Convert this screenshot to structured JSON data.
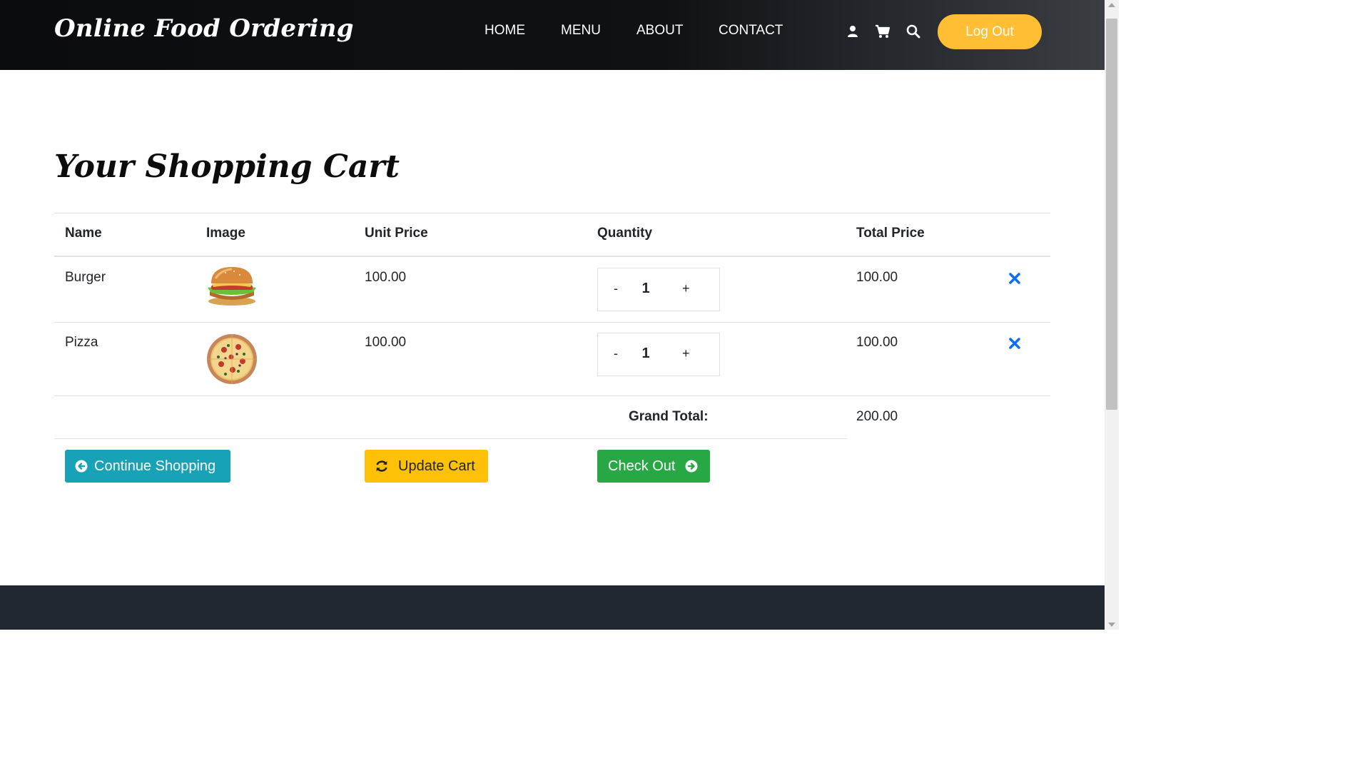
{
  "header": {
    "brand": "Online Food Ordering",
    "nav": [
      "HOME",
      "MENU",
      "ABOUT",
      "CONTACT"
    ],
    "icons": [
      "user-icon",
      "cart-icon",
      "search-icon"
    ],
    "logout_label": "Log Out",
    "accent_color": "#ffbe33"
  },
  "cart": {
    "title": "Your Shopping Cart",
    "columns": [
      "Name",
      "Image",
      "Unit Price",
      "Quantity",
      "Total Price"
    ],
    "items": [
      {
        "name": "Burger",
        "image_icon": "burger-image",
        "unit_price": "100.00",
        "qty_minus": "-",
        "quantity": "1",
        "qty_plus": "+",
        "total_price": "100.00",
        "remove_icon": "remove-icon"
      },
      {
        "name": "Pizza",
        "image_icon": "pizza-image",
        "unit_price": "100.00",
        "qty_minus": "-",
        "quantity": "1",
        "qty_plus": "+",
        "total_price": "100.00",
        "remove_icon": "remove-icon"
      }
    ],
    "grand_total_label": "Grand Total:",
    "grand_total_value": "200.00"
  },
  "actions": {
    "continue_label": "Continue Shopping",
    "update_label": "Update Cart",
    "checkout_label": "Check Out",
    "continue_color": "#17a2b8",
    "update_color": "#ffc107",
    "checkout_color": "#28a745"
  },
  "footer": {
    "color": "#222831"
  }
}
